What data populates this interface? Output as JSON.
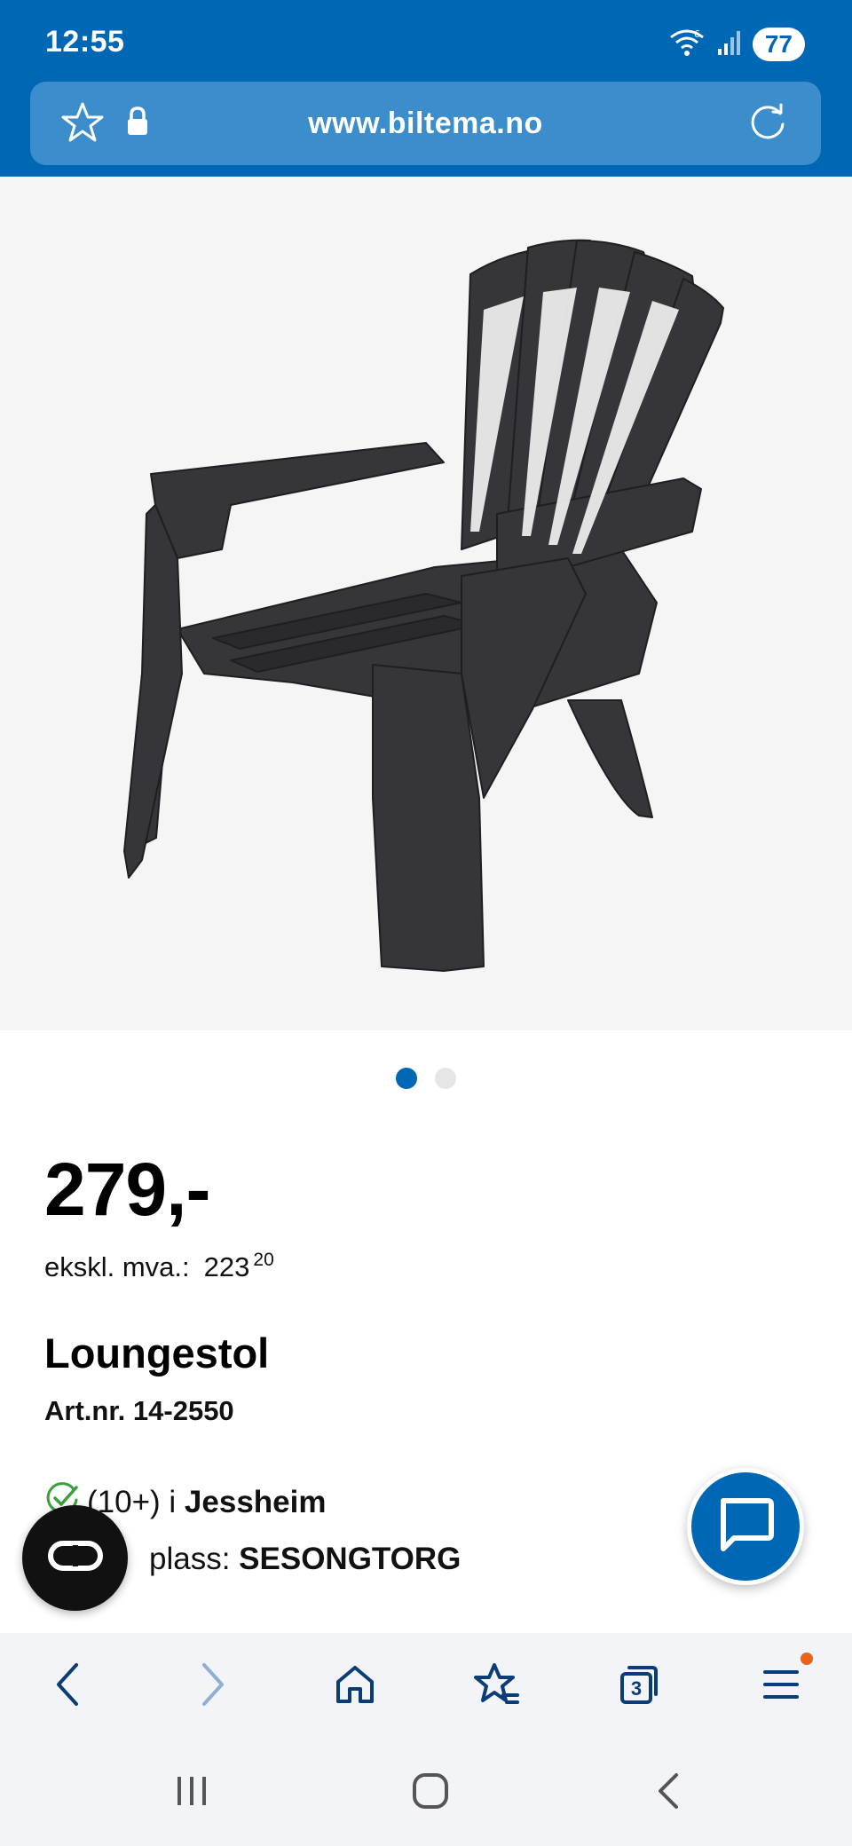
{
  "status_bar": {
    "time": "12:55",
    "battery": "77"
  },
  "url_bar": {
    "url": "www.biltema.no"
  },
  "gallery": {
    "image_alt": "chair",
    "dots_total": 2,
    "active_dot": 1
  },
  "product": {
    "price": "279,-",
    "vat_label": "ekskl. mva.:",
    "vat_value": "223",
    "vat_cents": "20",
    "title": "Loungestol",
    "article_number": "Art.nr. 14-2550",
    "stock_count": "(10+) i",
    "stock_store": "Jessheim",
    "location_label": "plass:",
    "location_value": "SESONGTORG"
  },
  "toolbar": {
    "icons": [
      "back-icon",
      "forward-icon",
      "home-icon",
      "bookmarks-icon",
      "tabs-icon",
      "menu-icon"
    ],
    "tabs_count": "3"
  },
  "colors": {
    "brand_blue": "#0067b5",
    "url_bar_blue": "#3b8ecb",
    "toolbar_icon": "#0a3d78",
    "notification_dot": "#e8641b",
    "check_green": "#3aa13a"
  }
}
